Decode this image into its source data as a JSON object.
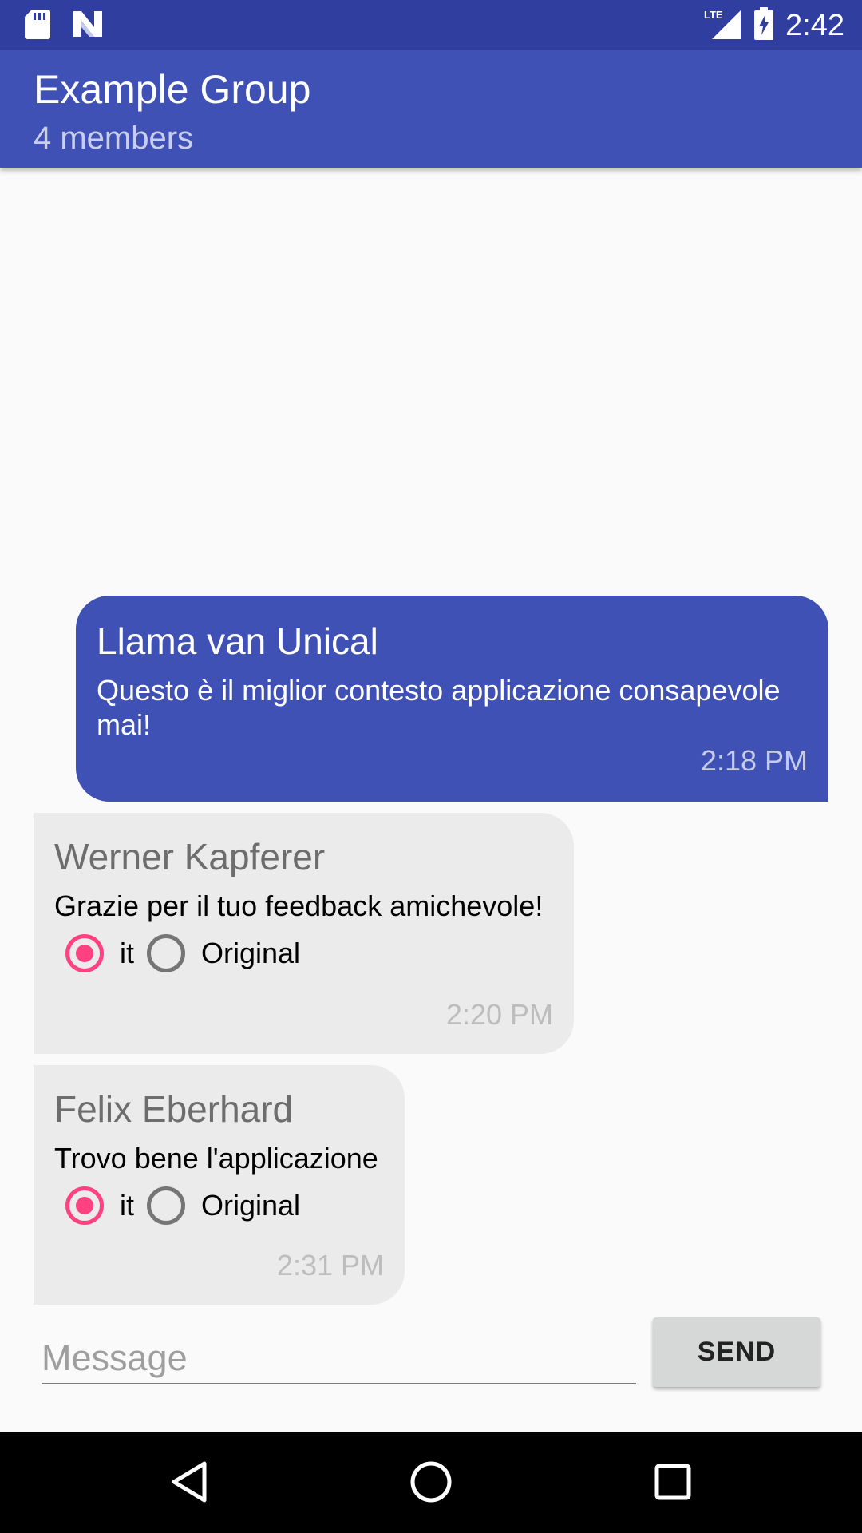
{
  "status_bar": {
    "time": "2:42",
    "left_icons": [
      "sd-card-icon",
      "n-logo-icon"
    ],
    "right_icons": [
      "lte-signal-icon",
      "battery-icon"
    ],
    "network_label": "LTE"
  },
  "app_bar": {
    "title": "Example Group",
    "subtitle": "4 members",
    "color": "#3f51b5"
  },
  "messages": [
    {
      "direction": "outgoing",
      "sender": "Llama van Unical",
      "text": "Questo è il miglior contesto applicazione consapevole mai!",
      "time": "2:18 PM"
    },
    {
      "direction": "incoming",
      "sender": "Werner Kapferer",
      "text": "Grazie per il tuo feedback amichevole!",
      "options": [
        {
          "label": "it",
          "checked": true
        },
        {
          "label": "Original",
          "checked": false
        }
      ],
      "time": "2:20 PM"
    },
    {
      "direction": "incoming",
      "sender": "Felix Eberhard",
      "text": "Trovo bene l'applicazione",
      "options": [
        {
          "label": "it",
          "checked": true
        },
        {
          "label": "Original",
          "checked": false
        }
      ],
      "time": "2:31 PM"
    }
  ],
  "composer": {
    "placeholder": "Message",
    "value": "",
    "send_label": "SEND"
  },
  "nav_bar": {
    "buttons": [
      "back-icon",
      "home-icon",
      "recents-icon"
    ]
  },
  "colors": {
    "primary_dark": "#303f9f",
    "primary": "#3f51b5",
    "accent": "#ff4081",
    "incoming_bubble": "#ebebeb"
  }
}
